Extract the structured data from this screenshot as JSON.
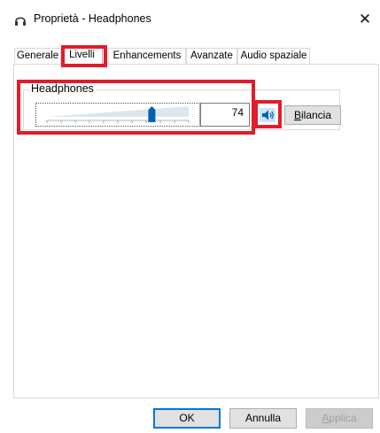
{
  "window": {
    "title": "Proprietà - Headphones",
    "icon": "headphones-icon",
    "close_label": "✕"
  },
  "tabs": [
    {
      "label": "Generale",
      "active": false
    },
    {
      "label": "Livelli",
      "active": true
    },
    {
      "label": "Enhancements",
      "active": false
    },
    {
      "label": "Avanzate",
      "active": false
    },
    {
      "label": "Audio spaziale",
      "active": false
    }
  ],
  "levels": {
    "group_title": "Headphones",
    "volume_value": "74",
    "volume_fraction": 0.74,
    "mute_icon": "speaker-icon",
    "balance_button": {
      "underlined": "B",
      "rest": "ilancia"
    }
  },
  "footer": {
    "ok": "OK",
    "cancel": "Annulla",
    "apply": {
      "underlined": "A",
      "rest": "pplica"
    }
  },
  "colors": {
    "highlight": "#e01d2a",
    "accent": "#0078d7",
    "slider_thumb": "#0063b1"
  }
}
